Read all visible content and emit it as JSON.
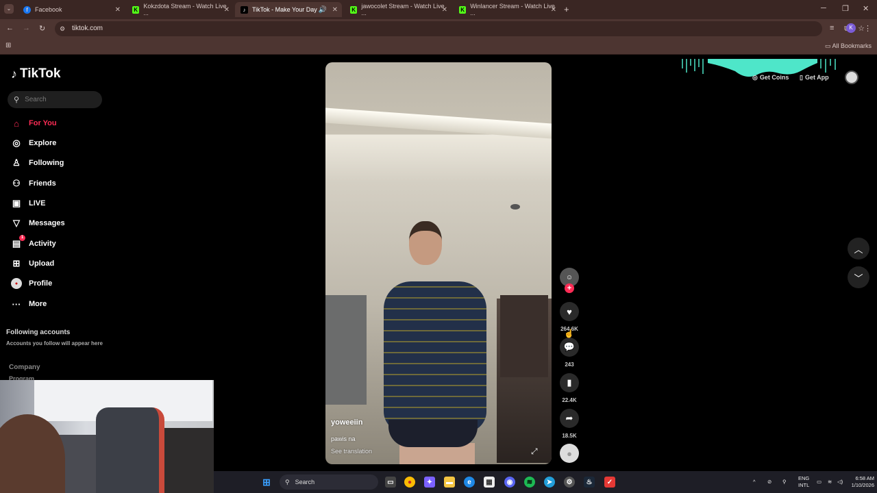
{
  "browser": {
    "tabs": [
      {
        "title": "Facebook",
        "icon": "facebook-icon",
        "color": "#1877f2"
      },
      {
        "title": "Kokzdota Stream - Watch Live ...",
        "icon": "kick-icon",
        "color": "#53fc18"
      },
      {
        "title": "TikTok - Make Your Day",
        "icon": "tiktok-icon",
        "color": "#000000",
        "active": true
      },
      {
        "title": "jawocolet Stream - Watch Live ...",
        "icon": "kick-icon",
        "color": "#53fc18"
      },
      {
        "title": "Winlancer Stream - Watch Live ...",
        "icon": "kick-icon",
        "color": "#53fc18"
      }
    ],
    "url": "tiktok.com",
    "bookmarks_label": "All Bookmarks"
  },
  "tiktok": {
    "logo": "TikTok",
    "search_placeholder": "Search",
    "nav": [
      {
        "label": "For You",
        "icon": "home-icon",
        "active": true
      },
      {
        "label": "Explore",
        "icon": "compass-icon"
      },
      {
        "label": "Following",
        "icon": "following-icon"
      },
      {
        "label": "Friends",
        "icon": "friends-icon"
      },
      {
        "label": "LIVE",
        "icon": "live-icon"
      },
      {
        "label": "Messages",
        "icon": "messages-icon"
      },
      {
        "label": "Activity",
        "icon": "activity-icon",
        "badge": "1"
      },
      {
        "label": "Upload",
        "icon": "upload-icon"
      },
      {
        "label": "Profile",
        "icon": "avatar-icon"
      },
      {
        "label": "More",
        "icon": "more-icon"
      }
    ],
    "following_accounts": "Following accounts",
    "following_note": "Accounts you follow will appear here",
    "company": "Company",
    "program": "Program",
    "top_right": {
      "get_coins": "Get Coins",
      "get_app": "Get App"
    },
    "video": {
      "username": "yoweeiin",
      "caption": "pawis na",
      "see_translation": "See translation"
    },
    "actions": {
      "likes": "264.6K",
      "comments": "243",
      "saves": "22.4K",
      "shares": "18.5K"
    }
  },
  "taskbar": {
    "search": "Search",
    "lang_top": "ENG",
    "lang_bottom": "INTL",
    "time": "6:58 AM",
    "date": "1/10/2026"
  },
  "colors": {
    "accent": "#fe2c55",
    "chrome": "#4d3531"
  }
}
